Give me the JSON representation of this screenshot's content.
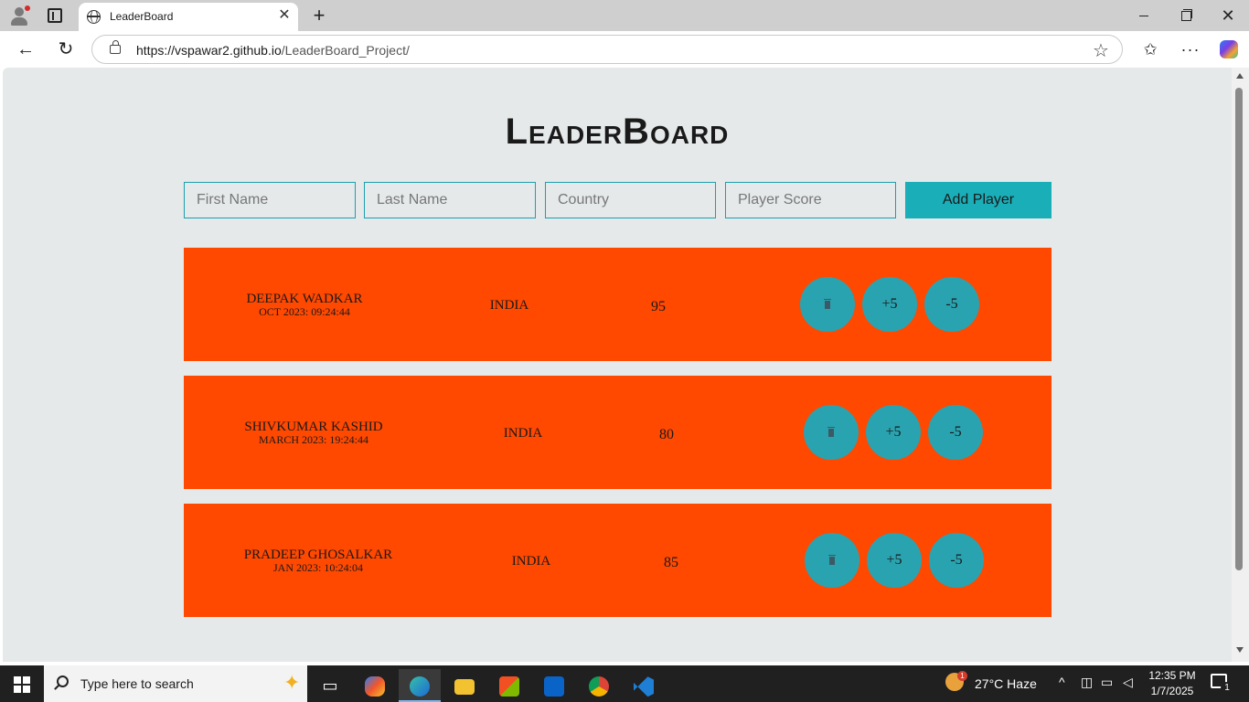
{
  "browser": {
    "tab_title": "LeaderBoard",
    "url_host": "https://vspawar2.github.io",
    "url_path": "/LeaderBoard_Project/",
    "tab_close": "✕",
    "new_tab": "+"
  },
  "page": {
    "title": "LeaderBoard",
    "form": {
      "first_name_placeholder": "First Name",
      "last_name_placeholder": "Last Name",
      "country_placeholder": "Country",
      "score_placeholder": "Player Score",
      "add_label": "Add Player"
    },
    "players": [
      {
        "name": "Deepak Wadkar",
        "date": "Oct 2023: 09:24:44",
        "country": "India",
        "score": "95",
        "plus_label": "+5",
        "minus_label": "-5"
      },
      {
        "name": "Shivkumar Kashid",
        "date": "March 2023: 19:24:44",
        "country": "India",
        "score": "80",
        "plus_label": "+5",
        "minus_label": "-5"
      },
      {
        "name": "Pradeep Ghosalkar",
        "date": "Jan 2023: 10:24:04",
        "country": "India",
        "score": "85",
        "plus_label": "+5",
        "minus_label": "-5"
      }
    ],
    "colors": {
      "row_bg": "#ff4800",
      "button_bg": "#2aa3b0",
      "add_button_bg": "#1aaeb8",
      "page_bg": "#e5e9ea"
    }
  },
  "taskbar": {
    "search_placeholder": "Type here to search",
    "weather": "27°C  Haze",
    "weather_badge": "1",
    "time": "12:35 PM",
    "date": "1/7/2025",
    "notification_count": "1"
  }
}
